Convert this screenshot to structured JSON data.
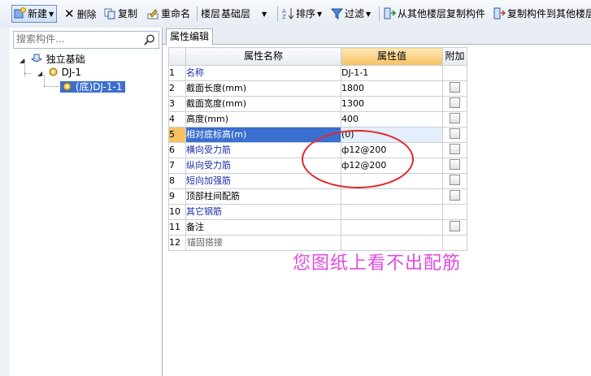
{
  "toolbar": {
    "new_label": "新建",
    "delete_label": "删除",
    "copy_label": "复制",
    "rename_label": "重命名",
    "floor_label": "楼层",
    "floor_value": "基础层",
    "sort_label": "排序",
    "filter_label": "过滤",
    "copy_from_other_floor_label": "从其他楼层复制构件",
    "copy_to_other_floor_label": "复制构件到其他楼层"
  },
  "search": {
    "placeholder": "搜索构件..."
  },
  "tree": {
    "root": "独立基础",
    "child": "DJ-1",
    "grandchild": "(底)DJ-1-1"
  },
  "tab": {
    "label": "属性编辑"
  },
  "table": {
    "headers": {
      "name": "属性名称",
      "value": "属性值",
      "extra": "附加"
    },
    "rows": [
      {
        "num": "1",
        "name": "名称",
        "value": "DJ-1-1",
        "checkbox": false,
        "style": "blue"
      },
      {
        "num": "2",
        "name": "截面长度(mm)",
        "value": "1800",
        "checkbox": true,
        "style": "black"
      },
      {
        "num": "3",
        "name": "截面宽度(mm)",
        "value": "1300",
        "checkbox": true,
        "style": "black"
      },
      {
        "num": "4",
        "name": "高度(mm)",
        "value": "400",
        "checkbox": true,
        "style": "black"
      },
      {
        "num": "5",
        "name": "相对底标高(m)",
        "value": "(0)",
        "checkbox": true,
        "style": "selected"
      },
      {
        "num": "6",
        "name": "横向受力筋",
        "value": "ф12@200",
        "checkbox": true,
        "style": "blue"
      },
      {
        "num": "7",
        "name": "纵向受力筋",
        "value": "ф12@200",
        "checkbox": true,
        "style": "blue"
      },
      {
        "num": "8",
        "name": "短向加强筋",
        "value": "",
        "checkbox": true,
        "style": "blue"
      },
      {
        "num": "9",
        "name": "顶部柱间配筋",
        "value": "",
        "checkbox": true,
        "style": "black"
      },
      {
        "num": "10",
        "name": "其它钢筋",
        "value": "",
        "checkbox": false,
        "style": "blue"
      },
      {
        "num": "11",
        "name": "备注",
        "value": "",
        "checkbox": true,
        "style": "black"
      },
      {
        "num": "12",
        "name": "锚固搭接",
        "value": "",
        "checkbox": false,
        "style": "grey"
      }
    ]
  },
  "annotation": {
    "text": "您图纸上看不出配筋"
  },
  "colors": {
    "accent": "#3b6fcf",
    "header_value": "#f6c261",
    "annotation": "#e04ae0",
    "circle": "#e0262a"
  }
}
